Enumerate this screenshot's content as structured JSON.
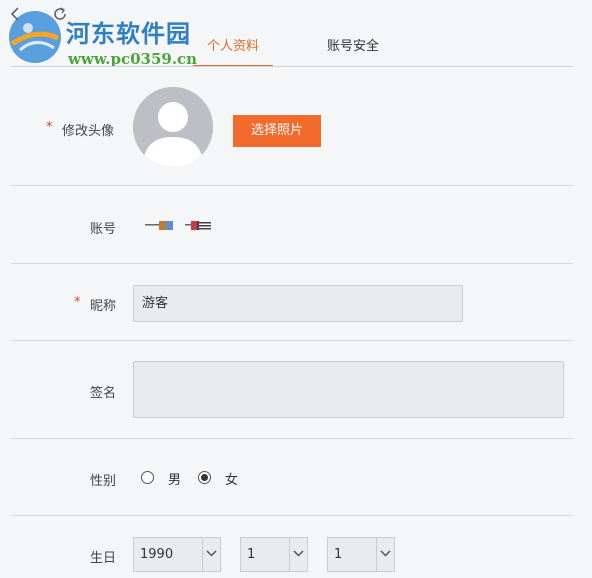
{
  "watermark": {
    "title": "河东软件园",
    "url": "www.pc0359.cn"
  },
  "tabs": [
    {
      "label": "个人资料",
      "active": true
    },
    {
      "label": "账号安全",
      "active": false
    }
  ],
  "form": {
    "avatar": {
      "label": "修改头像",
      "required_mark": "*",
      "button_label": "选择照片"
    },
    "account": {
      "label": "账号"
    },
    "nickname": {
      "label": "昵称",
      "required_mark": "*",
      "value": "游客"
    },
    "signature": {
      "label": "签名",
      "value": ""
    },
    "gender": {
      "label": "性别",
      "options": [
        "男",
        "女"
      ],
      "selected": "女"
    },
    "birthday": {
      "label": "生日",
      "year": "1990",
      "month": "1",
      "day": "1"
    }
  },
  "colors": {
    "accent": "#f36b2c",
    "tab_active_text": "#e06a2d",
    "required": "#e0442a",
    "watermark_blue": "#2e7fc8",
    "watermark_green": "#4aa43a"
  }
}
